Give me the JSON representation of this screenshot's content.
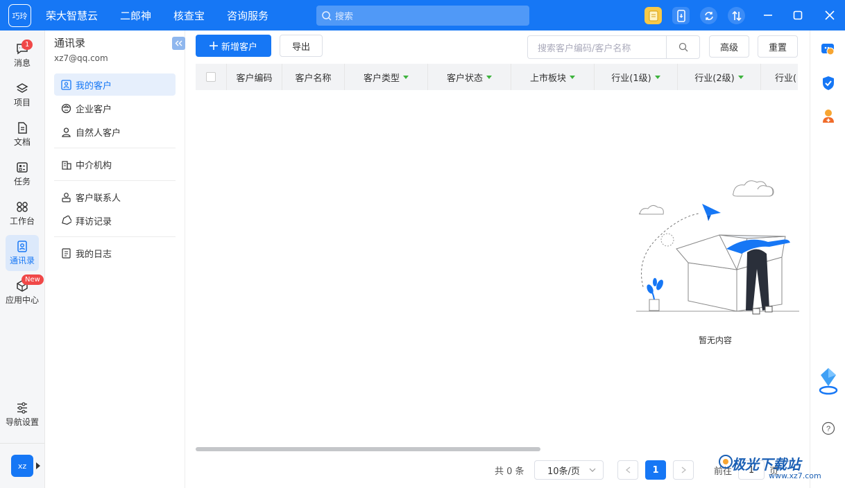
{
  "app": {
    "logo_text": "巧玲"
  },
  "topnav": {
    "items": [
      "荣大智慧云",
      "二郎神",
      "核查宝",
      "咨询服务"
    ]
  },
  "search": {
    "placeholder": "搜索"
  },
  "leftnav": {
    "items": [
      {
        "label": "消息",
        "icon": "message-icon",
        "badge": "1"
      },
      {
        "label": "项目",
        "icon": "project-icon"
      },
      {
        "label": "文档",
        "icon": "document-icon"
      },
      {
        "label": "任务",
        "icon": "task-icon"
      },
      {
        "label": "工作台",
        "icon": "workbench-icon"
      },
      {
        "label": "通讯录",
        "icon": "contacts-icon",
        "active": true
      },
      {
        "label": "应用中心",
        "icon": "app-center-icon",
        "badge": "New"
      }
    ],
    "nav_settings": "导航设置",
    "avatar": "xz"
  },
  "sidebar": {
    "title": "通讯录",
    "email": "xz7@qq.com",
    "items": [
      "我的客户",
      "企业客户",
      "自然人客户",
      "中介机构",
      "客户联系人",
      "拜访记录",
      "我的日志"
    ]
  },
  "toolbar": {
    "add_label": "新增客户",
    "export_label": "导出",
    "search_placeholder": "搜索客户编码/客户名称",
    "advanced_label": "高级",
    "reset_label": "重置"
  },
  "table": {
    "columns": [
      "客户编码",
      "客户名称",
      "客户类型",
      "客户状态",
      "上市板块",
      "行业(1级)",
      "行业(2级)",
      "行业("
    ],
    "filter_columns": [
      false,
      false,
      true,
      true,
      true,
      true,
      true,
      false
    ],
    "rows": [],
    "empty_text": "暂无内容"
  },
  "pagination": {
    "total_text": "共 0 条",
    "page_size": "10条/页",
    "current_page": "1",
    "goto_label": "前往",
    "goto_value": "1",
    "page_suffix": "页"
  },
  "watermark": {
    "title": "极光下载站",
    "url": "www.xz7.com"
  },
  "colors": {
    "primary": "#1677f5",
    "badge": "#f04848",
    "filter_caret": "#3db33d"
  }
}
